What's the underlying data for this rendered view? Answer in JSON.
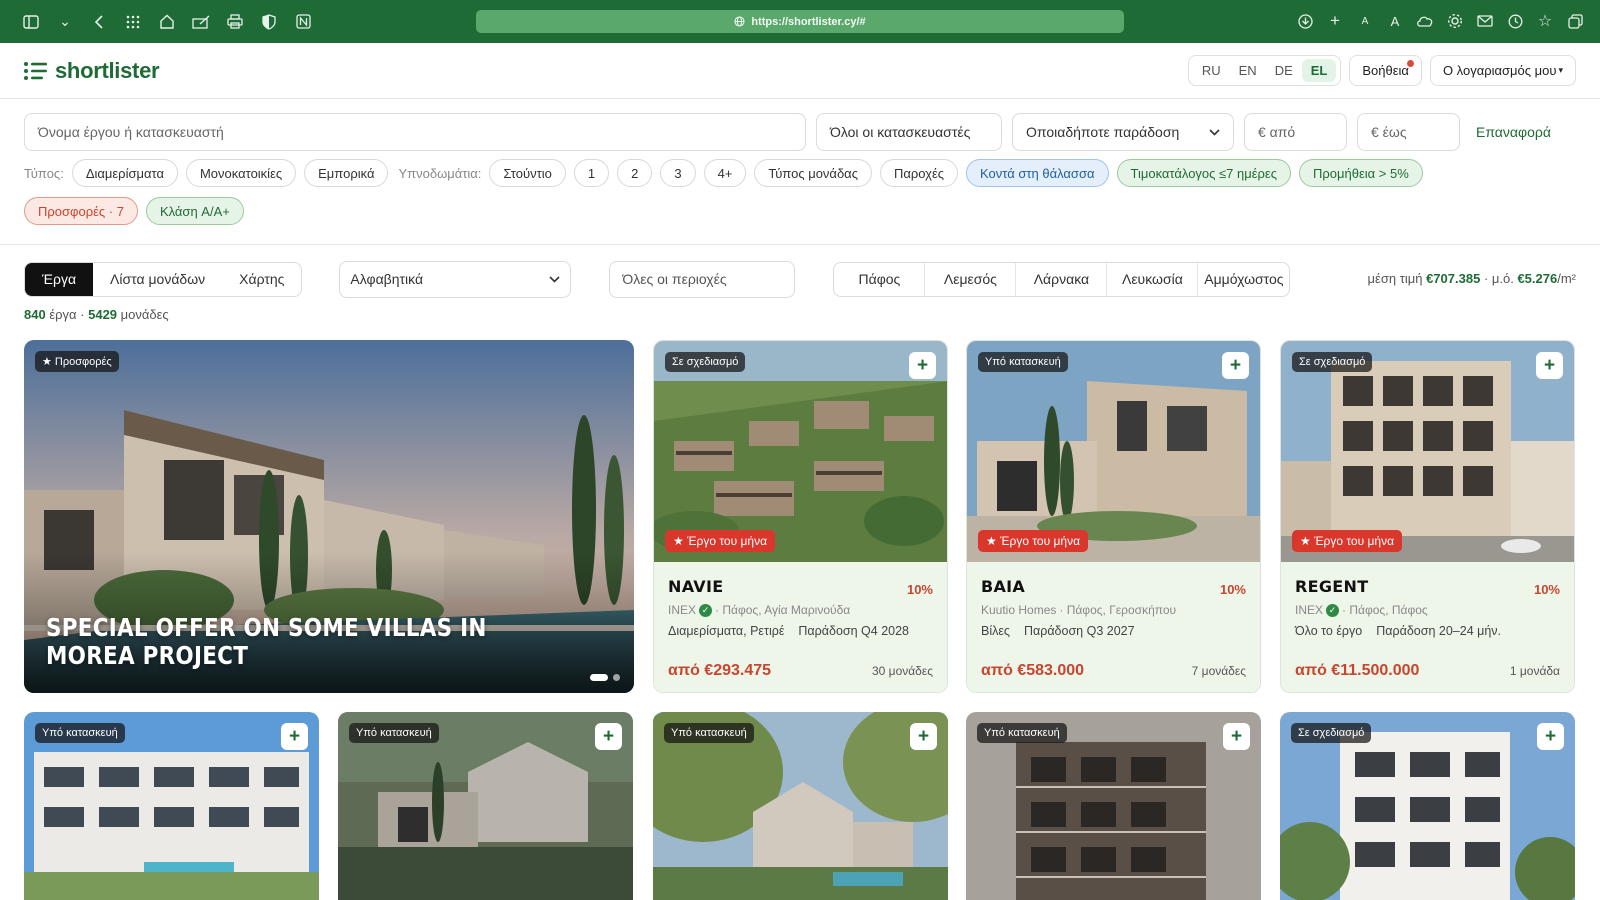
{
  "browser": {
    "url": "https://shortlister.cy/#"
  },
  "header": {
    "logo": "shortlister",
    "langs": [
      "RU",
      "EN",
      "DE",
      "EL"
    ],
    "active_lang": "EL",
    "help": "Βοήθεια",
    "account": "Ο λογαριασμός μου"
  },
  "filters": {
    "search_placeholder": "Όνομα έργου ή κατασκευαστή",
    "developer": "Όλοι οι κατασκευαστές",
    "delivery": "Οποιαδήποτε παράδοση",
    "price_from": "€ από",
    "price_to": "€ έως",
    "reset": "Επαναφορά",
    "type_label": "Τύπος:",
    "types": [
      "Διαμερίσματα",
      "Μονοκατοικίες",
      "Εμπορικά"
    ],
    "bedrooms_label": "Υπνοδωμάτια:",
    "bedrooms": [
      "Στούντιο",
      "1",
      "2",
      "3",
      "4+"
    ],
    "unit_type": "Τύπος μονάδας",
    "amenities": "Παροχές",
    "near_sea": "Κοντά στη θάλασσα",
    "pricelist": "Τιμοκατάλογος ≤7 ημέρες",
    "commission": "Προμήθεια > 5%",
    "offers": "Προσφορές · 7",
    "energy": "Κλάση A/A+"
  },
  "toolbar": {
    "views": [
      "Έργα",
      "Λίστα μονάδων",
      "Χάρτης"
    ],
    "active_view": "Έργα",
    "sort": "Αλφαβητικά",
    "regions": "Όλες οι περιοχές",
    "cities": [
      "Πάφος",
      "Λεμεσός",
      "Λάρνακα",
      "Λευκωσία",
      "Αμμόχωστος"
    ],
    "avg_label": "μέση τιμή",
    "avg_price": "€707.385",
    "avg_sep": "· μ.ό.",
    "avg_sqm": "€5.276",
    "avg_unit": "/m²"
  },
  "counts": {
    "projects": "840",
    "projects_label": "έργα ·",
    "units": "5429",
    "units_label": "μονάδες"
  },
  "featured": {
    "badge": "★ Προσφορές",
    "title": "SPECIAL OFFER ON SOME VILLAS IN MOREA PROJECT"
  },
  "cards": [
    {
      "status": "Σε σχεδιασμό",
      "month": "★ Έργο του μήνα",
      "name": "NAVIE",
      "pct": "10%",
      "developer": "INEX",
      "location": "· Πάφος, Αγία Μαρινούδα",
      "type": "Διαμερίσματα, Ρετιρέ",
      "delivery": "Παράδοση Q4 2028",
      "price": "από €293.475",
      "units": "30 μονάδες",
      "verified": true
    },
    {
      "status": "Υπό κατασκευή",
      "month": "★ Έργο του μήνα",
      "name": "BAIA",
      "pct": "10%",
      "developer": "Kuutio Homes",
      "location": "· Πάφος, Γεροσκήπου",
      "type": "Βίλες",
      "delivery": "Παράδοση Q3 2027",
      "price": "από €583.000",
      "units": "7 μονάδες",
      "verified": false
    },
    {
      "status": "Σε σχεδιασμό",
      "month": "★ Έργο του μήνα",
      "name": "REGENT",
      "pct": "10%",
      "developer": "INEX",
      "location": "· Πάφος, Πάφος",
      "type": "Όλο το έργο",
      "delivery": "Παράδοση 20–24 μήν.",
      "price": "από €11.500.000",
      "units": "1 μονάδα",
      "verified": true
    }
  ],
  "row2": [
    {
      "status": "Υπό κατασκευή"
    },
    {
      "status": "Υπό κατασκευή"
    },
    {
      "status": "Υπό κατασκευή"
    },
    {
      "status": "Υπό κατασκευή"
    },
    {
      "status": "Σε σχεδιασμό"
    }
  ],
  "plus_label": "+"
}
